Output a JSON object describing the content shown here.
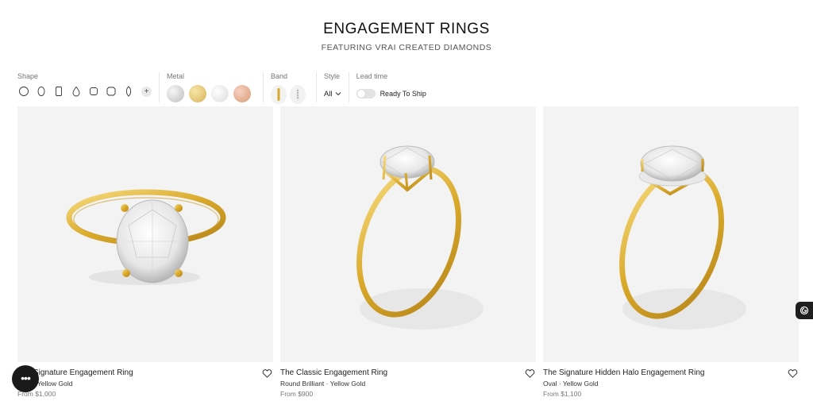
{
  "header": {
    "title": "ENGAGEMENT RINGS",
    "subtitle": "FEATURING VRAI CREATED DIAMONDS"
  },
  "filters": {
    "shape": {
      "label": "Shape",
      "options": [
        "round-icon",
        "oval-icon",
        "emerald-icon",
        "pear-icon",
        "cushion-icon",
        "radiant-icon",
        "marquise-icon"
      ],
      "more": "+"
    },
    "metal": {
      "label": "Metal",
      "options": [
        "platinum",
        "yellow-gold",
        "white-gold",
        "rose-gold"
      ]
    },
    "band": {
      "label": "Band",
      "options": [
        "plain-band-icon",
        "pave-band-icon"
      ]
    },
    "style": {
      "label": "Style",
      "value": "All"
    },
    "lead_time": {
      "label": "Lead time",
      "toggle_label": "Ready To Ship",
      "toggle_on": false
    }
  },
  "products": [
    {
      "title": "The Signature Engagement Ring",
      "subtitle": "Oval · Yellow Gold",
      "price": "From $1,000"
    },
    {
      "title": "The Classic Engagement Ring",
      "subtitle": "Round Brilliant · Yellow Gold",
      "price": "From $900"
    },
    {
      "title": "The Signature Hidden Halo Engagement Ring",
      "subtitle": "Oval · Yellow Gold",
      "price": "From $1,100"
    }
  ],
  "colors": {
    "gold": "#d9a92b",
    "gold_light": "#f3d774",
    "image_bg": "#f3f3f3"
  }
}
